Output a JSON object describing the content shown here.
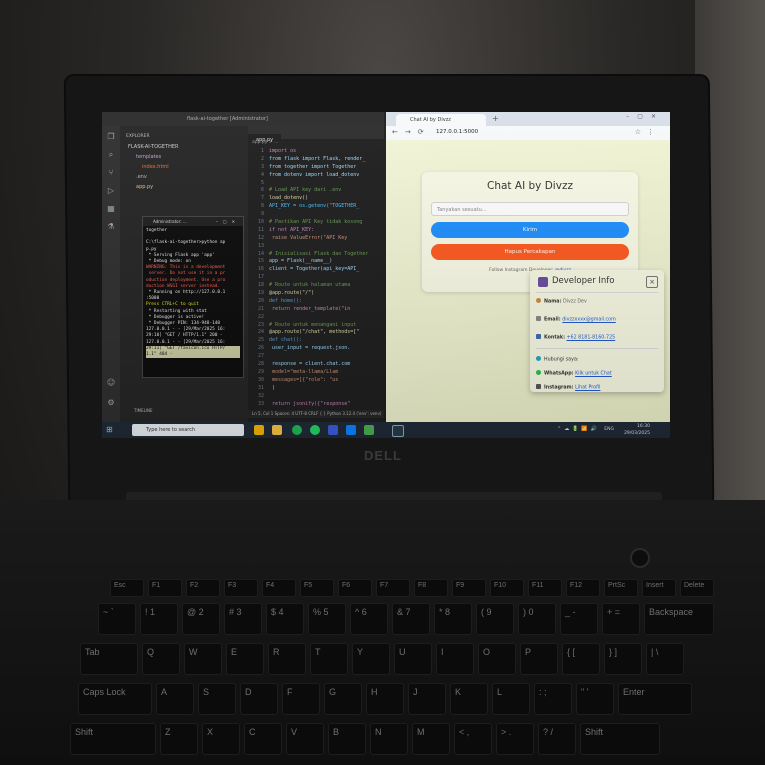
{
  "laptop": {
    "brand": "DELL"
  },
  "vscode": {
    "title": "flask-ai-together [Administrator]",
    "explorer_header": "EXPLORER",
    "project": "FLASK-AI-TOGETHER",
    "files": [
      "templates",
      "index.html",
      ".env",
      "app.py"
    ],
    "timeline": "TIMELINE",
    "tab": "app.py",
    "breadcrumb": "app.py > ...",
    "status": "Ln 5, Col 1  Spaces: 4  UTF-8  CRLF  { } Python  3.12.4 ('env': venv)",
    "code": [
      {
        "n": "1",
        "t": "import os",
        "c": "#c586c0"
      },
      {
        "n": "2",
        "t": "from flask import Flask, render_",
        "c": "#9cdcfe"
      },
      {
        "n": "3",
        "t": "from together import Together",
        "c": "#9cdcfe"
      },
      {
        "n": "4",
        "t": "from dotenv import load_dotenv",
        "c": "#9cdcfe"
      },
      {
        "n": "5",
        "t": "",
        "c": "#d4d4d4"
      },
      {
        "n": "6",
        "t": "# Load API key dari .env",
        "c": "#6a9955"
      },
      {
        "n": "7",
        "t": "load_dotenv()",
        "c": "#dcdcaa"
      },
      {
        "n": "8",
        "t": "API_KEY = os.getenv(\"TOGETHER_",
        "c": "#4fc1ff"
      },
      {
        "n": "9",
        "t": "",
        "c": "#d4d4d4"
      },
      {
        "n": "10",
        "t": "# Pastikan API Key tidak kosong",
        "c": "#6a9955"
      },
      {
        "n": "11",
        "t": "if not API_KEY:",
        "c": "#c586c0"
      },
      {
        "n": "12",
        "t": "    raise ValueError(\"API Key",
        "c": "#ce9178"
      },
      {
        "n": "13",
        "t": "",
        "c": "#d4d4d4"
      },
      {
        "n": "14",
        "t": "# Inisialisasi Flask dan Together",
        "c": "#6a9955"
      },
      {
        "n": "15",
        "t": "app = Flask(__name__)",
        "c": "#9cdcfe"
      },
      {
        "n": "16",
        "t": "client = Together(api_key=API_",
        "c": "#9cdcfe"
      },
      {
        "n": "17",
        "t": "",
        "c": "#d4d4d4"
      },
      {
        "n": "18",
        "t": "# Route untuk halaman utama",
        "c": "#6a9955"
      },
      {
        "n": "19",
        "t": "@app.route(\"/\")",
        "c": "#dcdcaa"
      },
      {
        "n": "20",
        "t": "def home():",
        "c": "#569cd6"
      },
      {
        "n": "21",
        "t": "    return render_template(\"in",
        "c": "#c586c0"
      },
      {
        "n": "22",
        "t": "",
        "c": "#d4d4d4"
      },
      {
        "n": "23",
        "t": "# Route untuk menangani input",
        "c": "#6a9955"
      },
      {
        "n": "24",
        "t": "@app.route(\"/chat\", methods=[\"",
        "c": "#dcdcaa"
      },
      {
        "n": "25",
        "t": "def chat():",
        "c": "#569cd6"
      },
      {
        "n": "26",
        "t": "    user_input = request.json.",
        "c": "#9cdcfe"
      },
      {
        "n": "27",
        "t": "",
        "c": "#d4d4d4"
      },
      {
        "n": "28",
        "t": "    response = client.chat.com",
        "c": "#9cdcfe"
      },
      {
        "n": "29",
        "t": "        model=\"meta-llama/Llam",
        "c": "#ce9178"
      },
      {
        "n": "30",
        "t": "        messages=[{\"role\": \"us",
        "c": "#ce9178"
      },
      {
        "n": "31",
        "t": "    )",
        "c": "#d4d4d4"
      },
      {
        "n": "32",
        "t": "",
        "c": "#d4d4d4"
      },
      {
        "n": "33",
        "t": "    return jsonify({\"response\"",
        "c": "#c586c0"
      }
    ]
  },
  "terminal": {
    "title": "Administrator: ...",
    "lines": [
      {
        "t": "together",
        "c": ""
      },
      {
        "t": "",
        "c": ""
      },
      {
        "t": "C:\\flask-ai-together>python ap",
        "c": ""
      },
      {
        "t": "p.py",
        "c": ""
      },
      {
        "t": " * Serving Flask app 'app'",
        "c": ""
      },
      {
        "t": " * Debug mode: on",
        "c": ""
      },
      {
        "t": "WARNING: This is a development",
        "c": "t-red"
      },
      {
        "t": " server. Do not use it in a pr",
        "c": "t-red"
      },
      {
        "t": "oduction deployment. Use a pro",
        "c": "t-red"
      },
      {
        "t": "duction WSGI server instead.",
        "c": "t-red"
      },
      {
        "t": " * Running on http://127.0.0.1",
        "c": ""
      },
      {
        "t": ":5000",
        "c": ""
      },
      {
        "t": "Press CTRL+C to quit",
        "c": "t-yel"
      },
      {
        "t": " * Restarting with stat",
        "c": ""
      },
      {
        "t": " * Debugger is active!",
        "c": ""
      },
      {
        "t": " * Debugger PIN: 134-948-140",
        "c": ""
      },
      {
        "t": "127.0.0.1 - - [29/Mar/2025 16:",
        "c": ""
      },
      {
        "t": "29:10] \"GET / HTTP/1.1\" 200 -",
        "c": ""
      },
      {
        "t": "127.0.0.1 - - [29/Mar/2025 16:",
        "c": ""
      },
      {
        "t": "29:11] \"GET /favicon.ico HTTP/",
        "c": "t-hl"
      },
      {
        "t": "1.1\" 404 -",
        "c": "t-hl"
      }
    ]
  },
  "browser": {
    "tab_title": "Chat AI by Divzz",
    "url": "127.0.0.1:5000",
    "chat": {
      "title": "Chat AI by Divzz",
      "input_placeholder": "Tanyakan sesuatu...",
      "send_label": "Kirim",
      "clear_label": "Hapus Percakapan",
      "follow_prefix": "Follow Instagram Developer:",
      "follow_handle": "@divzz"
    },
    "dev_info": {
      "title": "Developer Info",
      "close": "×",
      "name_label": "Nama:",
      "name_value": "Divzz Dev",
      "email_label": "Email:",
      "email_value": "divzzxxxx@gmail.com",
      "contact_label": "Kontak:",
      "contact_value": "+62 8181-8160-725",
      "hubungi": "Hubungi saya:",
      "wa_label": "WhatsApp:",
      "wa_value": "Klik untuk Chat",
      "ig_label": "Instagram:",
      "ig_value": "Lihat Profil"
    }
  },
  "taskbar": {
    "search_placeholder": "Type here to search",
    "lang": "ENG",
    "time": "16:30",
    "date": "29/03/2025"
  },
  "keyboard": {
    "fn_row": [
      "Esc",
      "F1",
      "F2",
      "F3",
      "F4",
      "F5",
      "F6",
      "F7",
      "F8",
      "F9",
      "F10",
      "F11",
      "F12",
      "PrtSc",
      "Insert",
      "Delete"
    ],
    "row1": [
      "~\n`",
      "!\n1",
      "@\n2",
      "#\n3",
      "$\n4",
      "%\n5",
      "^\n6",
      "&\n7",
      "*\n8",
      "(\n9",
      ")\n0",
      "_\n-",
      "+\n=",
      "Backspace"
    ],
    "row2": [
      "Tab",
      "Q",
      "W",
      "E",
      "R",
      "T",
      "Y",
      "U",
      "I",
      "O",
      "P",
      "{\n[",
      "}\n]",
      "|\n\\"
    ],
    "row3": [
      "Caps Lock",
      "A",
      "S",
      "D",
      "F",
      "G",
      "H",
      "J",
      "K",
      "L",
      ":\n;",
      "\"\n'",
      "Enter"
    ],
    "row4": [
      "Shift",
      "Z",
      "X",
      "C",
      "V",
      "B",
      "N",
      "M",
      "<\n,",
      ">\n.",
      "?\n/",
      "Shift"
    ]
  }
}
